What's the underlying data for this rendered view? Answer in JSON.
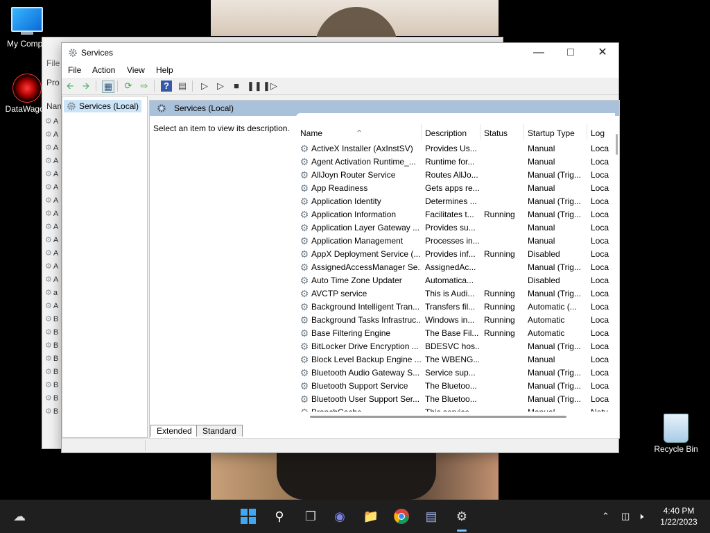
{
  "desktop": {
    "icons": [
      {
        "label": "My Compu"
      },
      {
        "label": "DataWagon"
      },
      {
        "label": "Recycle Bin"
      }
    ]
  },
  "back_window": {
    "menu": "File",
    "panel_label": "Pro",
    "column": "Nan"
  },
  "window": {
    "title": "Services",
    "menu": [
      "File",
      "Action",
      "View",
      "Help"
    ],
    "tree_selected": "Services (Local)",
    "pane_title": "Services (Local)",
    "description_hint": "Select an item to view its description.",
    "columns": {
      "name": "Name",
      "description": "Description",
      "status": "Status",
      "startup": "Startup Type",
      "log": "Log"
    },
    "rows": [
      {
        "name": "ActiveX Installer (AxInstSV)",
        "description": "Provides Us...",
        "status": "",
        "startup": "Manual",
        "log": "Loca"
      },
      {
        "name": "Agent Activation Runtime_...",
        "description": "Runtime for...",
        "status": "",
        "startup": "Manual",
        "log": "Loca"
      },
      {
        "name": "AllJoyn Router Service",
        "description": "Routes AllJo...",
        "status": "",
        "startup": "Manual (Trig...",
        "log": "Loca"
      },
      {
        "name": "App Readiness",
        "description": "Gets apps re...",
        "status": "",
        "startup": "Manual",
        "log": "Loca"
      },
      {
        "name": "Application Identity",
        "description": "Determines ...",
        "status": "",
        "startup": "Manual (Trig...",
        "log": "Loca"
      },
      {
        "name": "Application Information",
        "description": "Facilitates t...",
        "status": "Running",
        "startup": "Manual (Trig...",
        "log": "Loca"
      },
      {
        "name": "Application Layer Gateway ...",
        "description": "Provides su...",
        "status": "",
        "startup": "Manual",
        "log": "Loca"
      },
      {
        "name": "Application Management",
        "description": "Processes in...",
        "status": "",
        "startup": "Manual",
        "log": "Loca"
      },
      {
        "name": "AppX Deployment Service (...",
        "description": "Provides inf...",
        "status": "Running",
        "startup": "Disabled",
        "log": "Loca"
      },
      {
        "name": "AssignedAccessManager Se...",
        "description": "AssignedAc...",
        "status": "",
        "startup": "Manual (Trig...",
        "log": "Loca"
      },
      {
        "name": "Auto Time Zone Updater",
        "description": "Automatica...",
        "status": "",
        "startup": "Disabled",
        "log": "Loca"
      },
      {
        "name": "AVCTP service",
        "description": "This is Audi...",
        "status": "Running",
        "startup": "Manual (Trig...",
        "log": "Loca"
      },
      {
        "name": "Background Intelligent Tran...",
        "description": "Transfers fil...",
        "status": "Running",
        "startup": "Automatic (...",
        "log": "Loca"
      },
      {
        "name": "Background Tasks Infrastruc...",
        "description": "Windows in...",
        "status": "Running",
        "startup": "Automatic",
        "log": "Loca"
      },
      {
        "name": "Base Filtering Engine",
        "description": "The Base Fil...",
        "status": "Running",
        "startup": "Automatic",
        "log": "Loca"
      },
      {
        "name": "BitLocker Drive Encryption ...",
        "description": "BDESVC hos...",
        "status": "",
        "startup": "Manual (Trig...",
        "log": "Loca"
      },
      {
        "name": "Block Level Backup Engine ...",
        "description": "The WBENG...",
        "status": "",
        "startup": "Manual",
        "log": "Loca"
      },
      {
        "name": "Bluetooth Audio Gateway S...",
        "description": "Service sup...",
        "status": "",
        "startup": "Manual (Trig...",
        "log": "Loca"
      },
      {
        "name": "Bluetooth Support Service",
        "description": "The Bluetoo...",
        "status": "",
        "startup": "Manual (Trig...",
        "log": "Loca"
      },
      {
        "name": "Bluetooth User Support Ser...",
        "description": "The Bluetoo...",
        "status": "",
        "startup": "Manual (Trig...",
        "log": "Loca"
      },
      {
        "name": "BranchCache",
        "description": "This service ...",
        "status": "",
        "startup": "Manual",
        "log": "Netv"
      }
    ],
    "tabs": [
      "Extended",
      "Standard"
    ],
    "active_tab": "Extended"
  },
  "taskbar": {
    "time": "4:40 PM",
    "date": "1/22/2023",
    "accent": "#7cc4ff"
  }
}
